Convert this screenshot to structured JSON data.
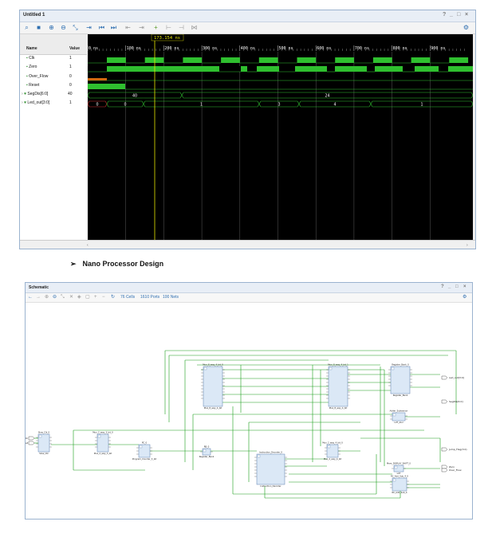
{
  "wave_window": {
    "title": "Untitled 1",
    "controls": [
      "?",
      "_",
      "□",
      "×"
    ],
    "gear": "⚙",
    "toolbar_icons": [
      "search-icon",
      "save-icon",
      "zoom-in-icon",
      "zoom-out-icon",
      "zoom-fit-icon",
      "cursor-icon",
      "go-first-icon",
      "go-last-icon",
      "prev-edge-icon",
      "next-edge-icon",
      "add-marker-icon",
      "prev-marker-icon",
      "next-marker-icon",
      "swap-icon"
    ],
    "cursor_time": "173.154 ns",
    "headers": {
      "name": "Name",
      "value": "Value"
    },
    "signals": [
      {
        "name": "Clk",
        "value": "1",
        "type": "bit"
      },
      {
        "name": "Zero",
        "value": "1",
        "type": "bit"
      },
      {
        "name": "Over_Flow",
        "value": "0",
        "type": "bit"
      },
      {
        "name": "Reset",
        "value": "0",
        "type": "bit"
      },
      {
        "name": "SegDis[6:0]",
        "value": "40",
        "type": "bus"
      },
      {
        "name": "Led_out[3:0]",
        "value": "1",
        "type": "bus"
      }
    ],
    "time_ticks": [
      "0 ns",
      "100 ns",
      "200 ns",
      "300 ns",
      "400 ns",
      "500 ns",
      "600 ns",
      "700 ns",
      "800 ns",
      "900 ns"
    ],
    "bus_segdis_values": [
      "40",
      "24"
    ],
    "bus_led_values": [
      "0",
      "0",
      "1",
      "3",
      "4",
      "1"
    ]
  },
  "caption": {
    "bullet": "➢",
    "text": "Nano Processor Design"
  },
  "schematic_window": {
    "title": "Schematic",
    "controls": [
      "?",
      "_",
      "□",
      "×"
    ],
    "gear": "⚙",
    "toolbar_stats": [
      "76 Cells",
      "1610 Ports",
      "100 Nets"
    ],
    "blocks": [
      {
        "name": "Slow_Clk_0",
        "sub": "Slow_Clk"
      },
      {
        "name": "Mux_2_way_3_bit_0",
        "sub": "Mux_2_way_3_bit"
      },
      {
        "name": "PC_0",
        "sub": "Program_Counter_3_bit"
      },
      {
        "name": "RB_0",
        "sub": "Register_Bank"
      },
      {
        "name": "Instruction_Decoder_0",
        "sub": "Instruction_Decoder"
      },
      {
        "name": "Mux_8_way_4_bit_0",
        "sub": "Mux_8_way_4_bit"
      },
      {
        "name": "Mux_8_way_4_bit_1",
        "sub": "Mux_8_way_4_bit"
      },
      {
        "name": "Mux_2_way_4_bit_0",
        "sub": "Mux_2_way_4_bit"
      },
      {
        "name": "Register_Bank_0",
        "sub": "Register_Bank"
      },
      {
        "name": "Adder_Subtractor",
        "sub": "LUT_ALU"
      },
      {
        "name": "Mem_DISPLAY_SHIFT_0",
        "sub": "LUT"
      },
      {
        "name": "RC_Add_Sub_4_0",
        "sub": "RC_Add_Sub_4"
      }
    ],
    "ports_in": [
      "Clk",
      "Reset"
    ],
    "ports_out": [
      "Led_out[3:0]",
      "SegDis[6:0]",
      "Jump_Flag(3:0)",
      "Zero",
      "Over_Flow"
    ]
  },
  "colors": {
    "wave_green": "#2fbf2f",
    "wave_bg": "#000000",
    "cursor": "#e8e800",
    "wire": "#1a9e1a",
    "block_fill": "#dbe8f6",
    "block_stroke": "#5a7fb0"
  }
}
